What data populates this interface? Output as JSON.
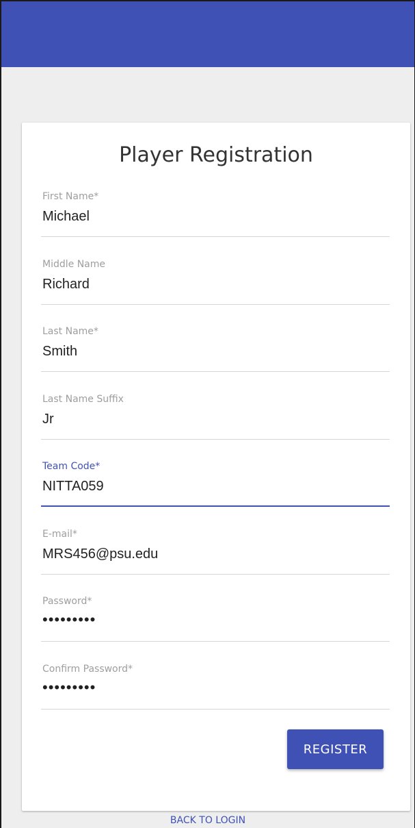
{
  "form": {
    "title": "Player Registration",
    "fields": [
      {
        "label": "First Name*",
        "value": "Michael"
      },
      {
        "label": "Middle Name",
        "value": "Richard"
      },
      {
        "label": "Last Name*",
        "value": "Smith"
      },
      {
        "label": "Last Name Suffix",
        "value": "Jr"
      },
      {
        "label": "Team Code*",
        "value": "NITTA059"
      },
      {
        "label": "E-mail*",
        "value": "MRS456@psu.edu"
      },
      {
        "label": "Password*",
        "value": "•••••••••"
      },
      {
        "label": "Confirm Password*",
        "value": "•••••••••"
      }
    ],
    "register_label": "REGISTER",
    "back_to_login_label": "BACK TO LOGIN"
  },
  "colors": {
    "primary": "#3f51b5",
    "background": "#eeeeee",
    "card": "#ffffff"
  }
}
